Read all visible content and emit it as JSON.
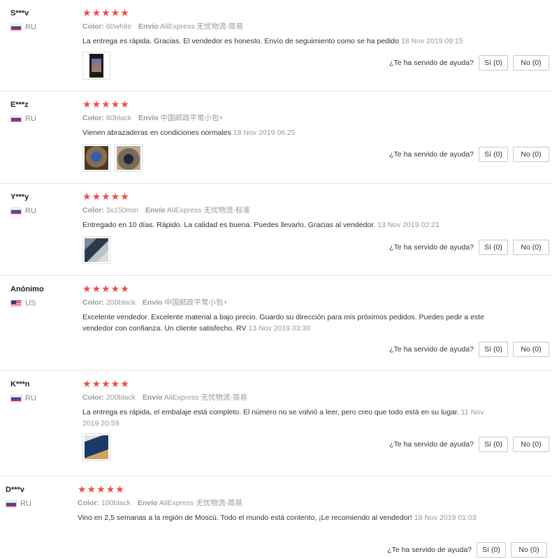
{
  "labels": {
    "color": "Color:",
    "shipping": "Envío",
    "helpful": "¿Te ha servido de ayuda?",
    "yes": "Sí (0)",
    "no": "No (0)"
  },
  "star_color": "#f24a43",
  "reviews": [
    {
      "user": "S***v",
      "country": "RU",
      "stars": 5,
      "color": "60white",
      "shipping": "AliExpress 无忧物流-简易",
      "text": "La entrega es rápida. Gracias. El vendedor es honesto. Envío de seguimiento como se ha pedido",
      "date": "18 Nov 2019 09:15",
      "photos": [
        "phone-photo"
      ]
    },
    {
      "user": "E***z",
      "country": "RU",
      "stars": 5,
      "color": "60black",
      "shipping": "中国邮政平常小包+",
      "text": "Vienen abrazaderas en condiciones normales",
      "date": "18 Nov 2019 06:25",
      "photos": [
        "clamp-photo-1",
        "clamp-photo-2"
      ]
    },
    {
      "user": "Y***y",
      "country": "RU",
      "stars": 5,
      "color": "3x150mm",
      "shipping": "AliExpress 无忧物流-标准",
      "text": "Entregado en 10 días. Rápido. La calidad es buena. Puedes llevarlo. Gracias al vendedor.",
      "date": "13 Nov 2019 02:21",
      "photos": [
        "pipe-photo"
      ]
    },
    {
      "user": "Anónimo",
      "country": "US",
      "stars": 5,
      "color": "200black",
      "shipping": "中国邮政平常小包+",
      "text": "Excelente vendedor. Excelente material a bajo precio. Guardo su dirección para mis próximos pedidos. Puedes pedir a este vendedor con confianza. Un cliente satisfecho. RV",
      "date": "13 Nov 2019 03:30",
      "photos": []
    },
    {
      "user": "K***n",
      "country": "RU",
      "stars": 5,
      "color": "200black",
      "shipping": "AliExpress 无忧物流-简易",
      "text": "La entrega es rápida, el embalaje está completo. El número no se volvió a leer, pero creo que todo está en su lugar.",
      "date": "11 Nov 2019 20:59",
      "photos": [
        "box-photo"
      ]
    },
    {
      "user": "D***v",
      "country": "RU",
      "stars": 5,
      "color": "100black",
      "shipping": "AliExpress 无忧物流-简易",
      "text": "Vino en 2,5 semanas a la región de Moscú. Todo el mundo está contento, ¡Le recomiendo al vendedor!",
      "date": "18 Nov 2019 01:03",
      "photos": []
    }
  ]
}
